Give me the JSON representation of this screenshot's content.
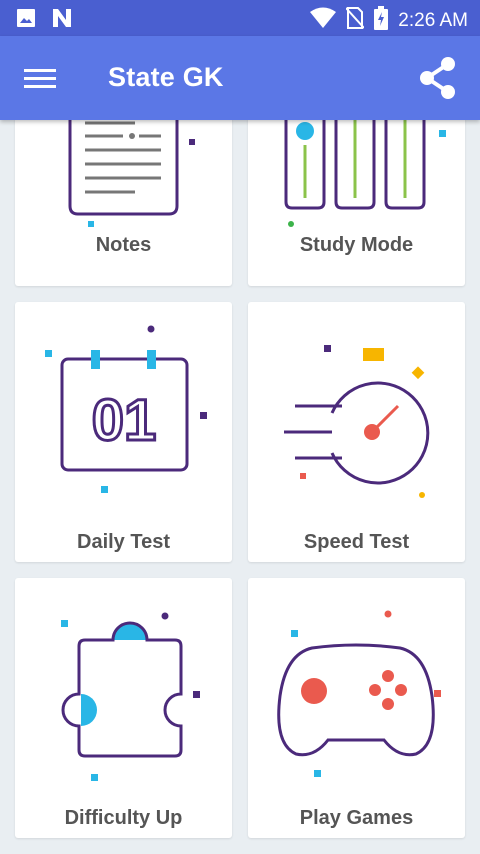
{
  "status_bar": {
    "time": "2:26 AM",
    "left_icons": [
      "image-icon",
      "n-app-icon"
    ],
    "right_icons": [
      "wifi-icon",
      "no-sim-icon",
      "battery-charging-icon"
    ]
  },
  "app_bar": {
    "title": "State GK",
    "menu_icon": "hamburger-menu-icon",
    "share_icon": "share-icon"
  },
  "cards": [
    {
      "label": "Notes",
      "icon": "notes-document-icon"
    },
    {
      "label": "Study Mode",
      "icon": "study-books-icon"
    },
    {
      "label": "Daily Test",
      "icon": "calendar-icon",
      "icon_text": "01"
    },
    {
      "label": "Speed Test",
      "icon": "speedometer-icon"
    },
    {
      "label": "Difficulty Up",
      "icon": "puzzle-piece-icon"
    },
    {
      "label": "Play Games",
      "icon": "game-controller-icon"
    }
  ],
  "colors": {
    "status_bar": "#4a5fd0",
    "app_bar": "#5b77e6",
    "background": "#e9eef2",
    "icon_outline": "#4b2a7b",
    "cyan_accent": "#29b6e6",
    "red_accent": "#ea5a4e",
    "green_accent": "#8bc34a",
    "yellow_accent": "#f7b500"
  }
}
